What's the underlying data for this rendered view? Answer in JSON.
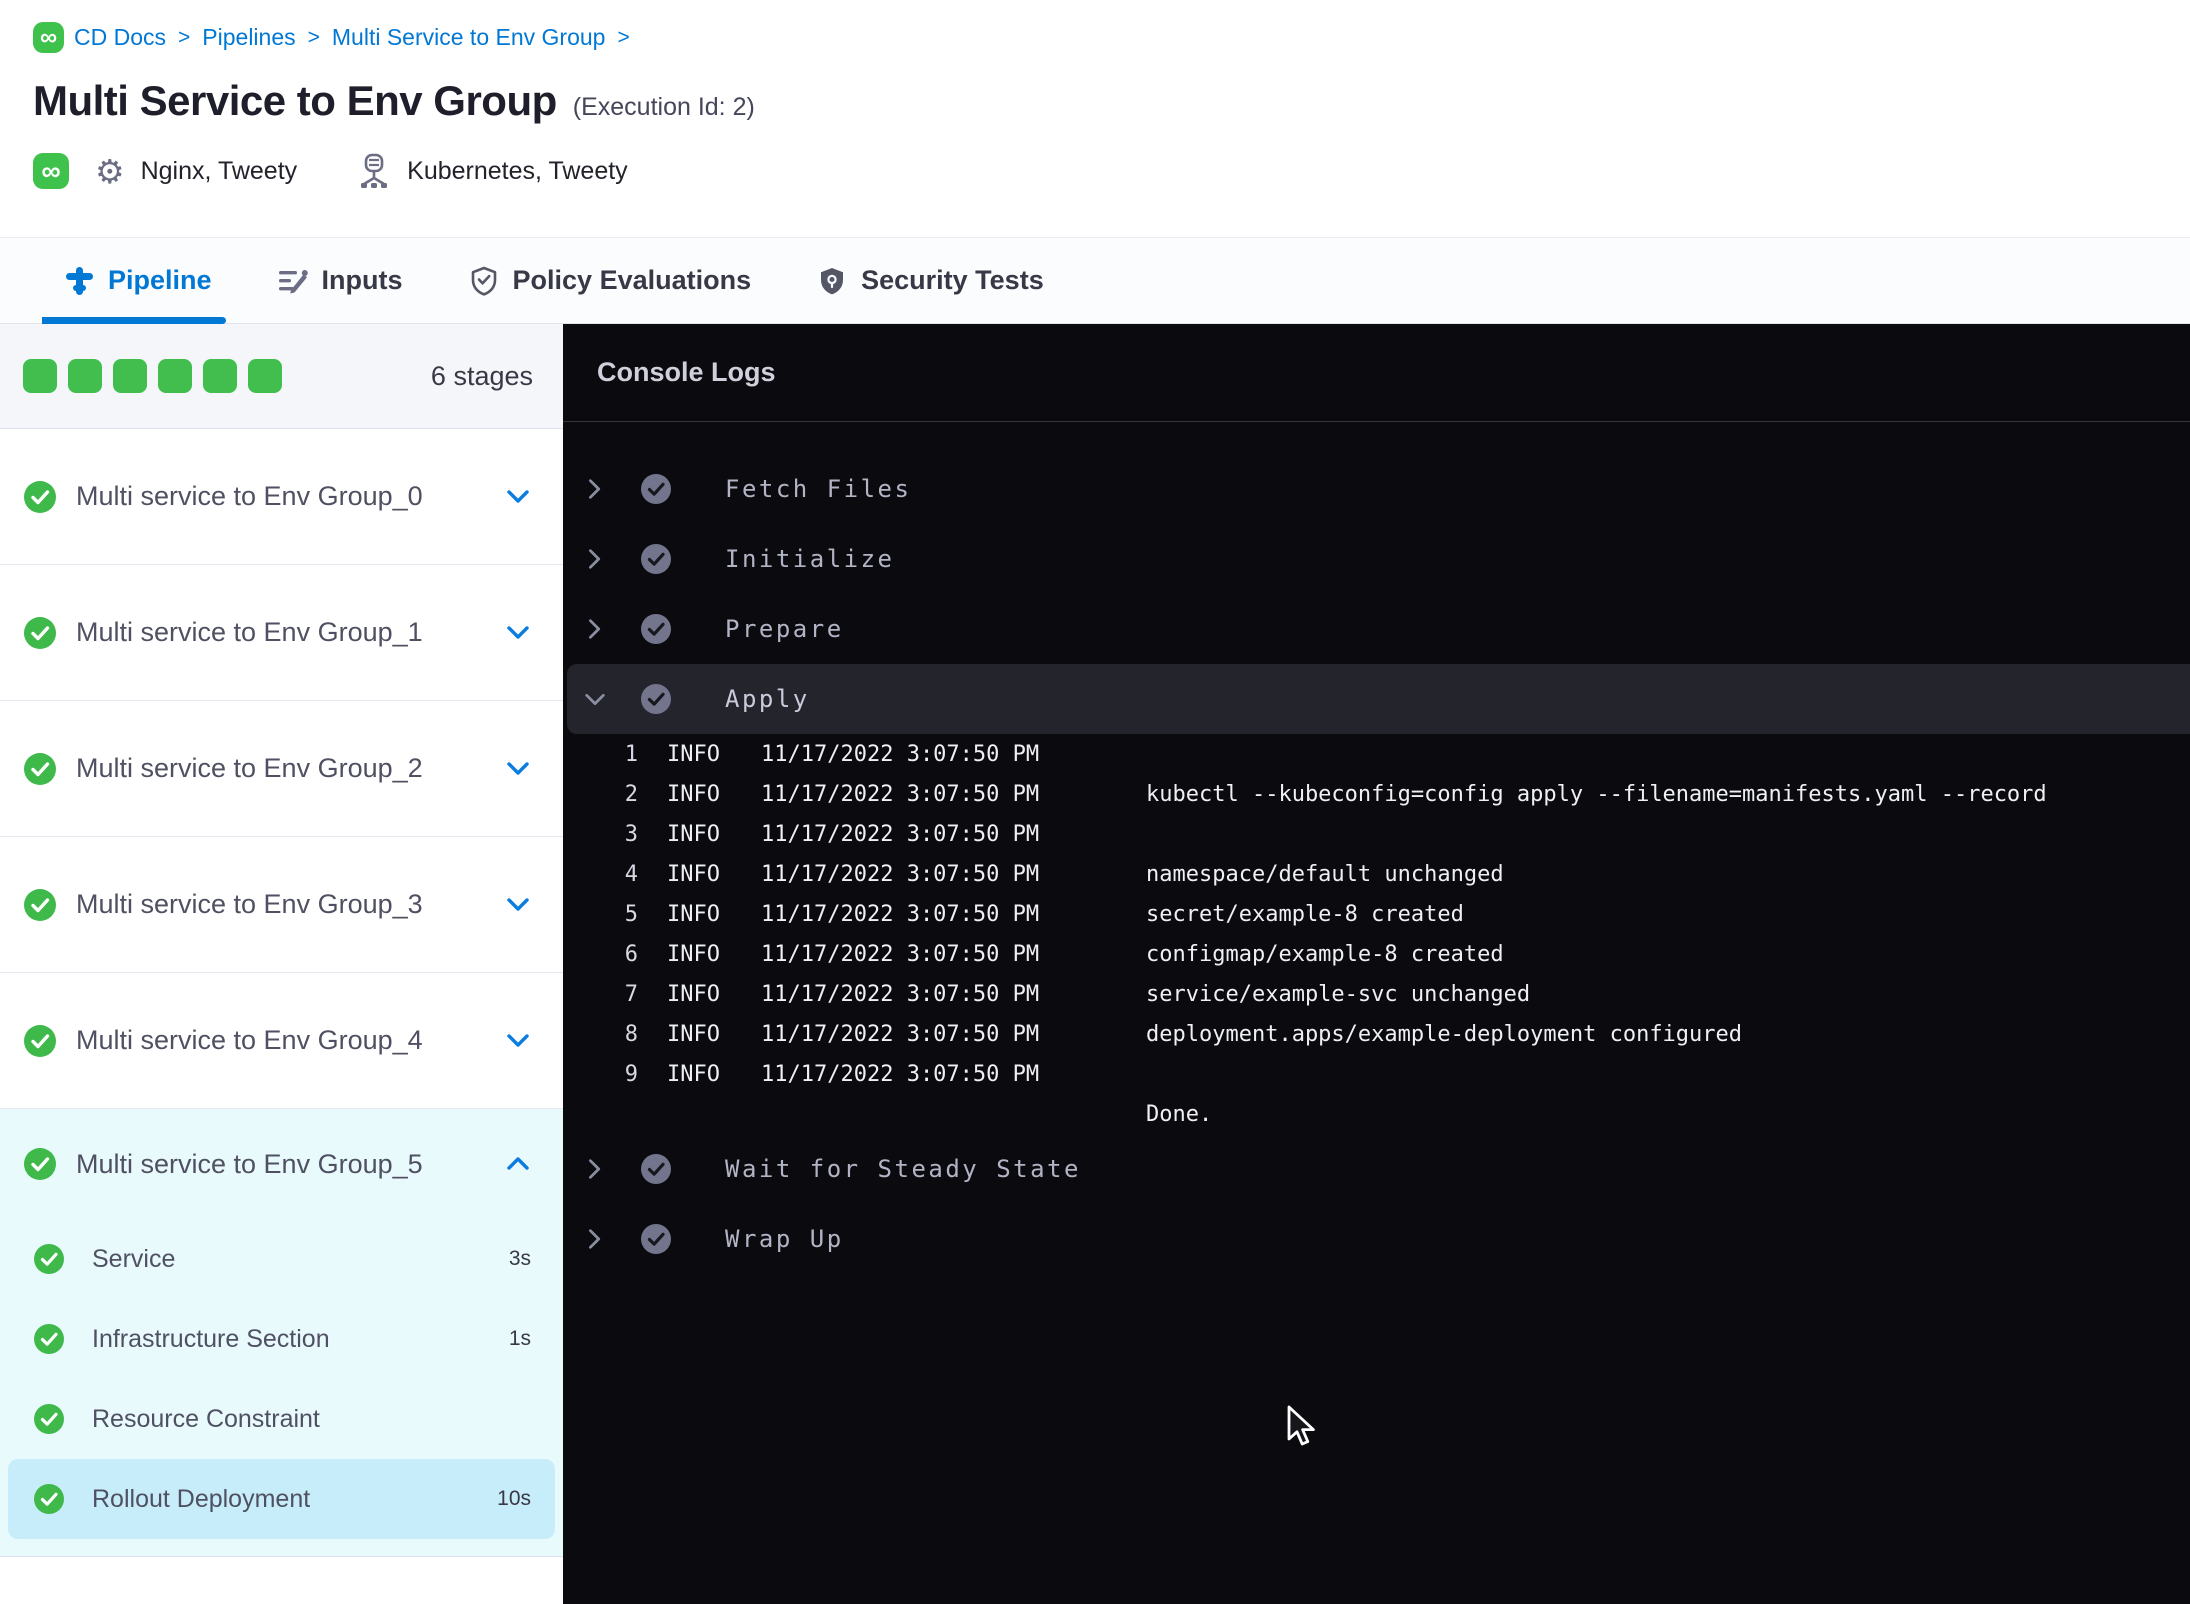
{
  "colors": {
    "accent_blue": "#0278d5",
    "success_green": "#42be4e",
    "console_bg": "#0b0b0f",
    "selected_step_bg": "#c8edfa"
  },
  "breadcrumb": {
    "separator": ">",
    "items": [
      "CD Docs",
      "Pipelines",
      "Multi Service to Env Group"
    ]
  },
  "header": {
    "title": "Multi Service to Env Group",
    "execution_id": "(Execution Id: 2)",
    "services": "Nginx, Tweety",
    "environments": "Kubernetes, Tweety"
  },
  "tabs": [
    {
      "label": "Pipeline",
      "icon": "pipeline-icon",
      "active": true
    },
    {
      "label": "Inputs",
      "icon": "inputs-icon",
      "active": false
    },
    {
      "label": "Policy Evaluations",
      "icon": "policy-shield-icon",
      "active": false
    },
    {
      "label": "Security Tests",
      "icon": "security-shield-icon",
      "active": false
    }
  ],
  "sidebar": {
    "stage_count_label": "6 stages",
    "completed_stage_squares": 6,
    "collapsed_stages": [
      "Multi service to Env Group_0",
      "Multi service to Env Group_1",
      "Multi service to Env Group_2",
      "Multi service to Env Group_3",
      "Multi service to Env Group_4"
    ],
    "expanded_stage": {
      "label": "Multi service to Env Group_5",
      "steps": [
        {
          "label": "Service",
          "duration": "3s",
          "selected": false
        },
        {
          "label": "Infrastructure Section",
          "duration": "1s",
          "selected": false
        },
        {
          "label": "Resource Constraint",
          "duration": "",
          "selected": false
        },
        {
          "label": "Rollout Deployment",
          "duration": "10s",
          "selected": true
        }
      ]
    }
  },
  "console": {
    "title": "Console Logs",
    "steps_before": [
      "Fetch Files",
      "Initialize",
      "Prepare"
    ],
    "apply": {
      "label": "Apply",
      "logs": [
        {
          "num": "1",
          "level": "INFO",
          "time": "11/17/2022 3:07:50 PM",
          "msg": ""
        },
        {
          "num": "2",
          "level": "INFO",
          "time": "11/17/2022 3:07:50 PM",
          "msg": "kubectl --kubeconfig=config apply --filename=manifests.yaml --record"
        },
        {
          "num": "3",
          "level": "INFO",
          "time": "11/17/2022 3:07:50 PM",
          "msg": ""
        },
        {
          "num": "4",
          "level": "INFO",
          "time": "11/17/2022 3:07:50 PM",
          "msg": "namespace/default unchanged"
        },
        {
          "num": "5",
          "level": "INFO",
          "time": "11/17/2022 3:07:50 PM",
          "msg": "secret/example-8 created"
        },
        {
          "num": "6",
          "level": "INFO",
          "time": "11/17/2022 3:07:50 PM",
          "msg": "configmap/example-8 created"
        },
        {
          "num": "7",
          "level": "INFO",
          "time": "11/17/2022 3:07:50 PM",
          "msg": "service/example-svc unchanged"
        },
        {
          "num": "8",
          "level": "INFO",
          "time": "11/17/2022 3:07:50 PM",
          "msg": "deployment.apps/example-deployment configured"
        },
        {
          "num": "9",
          "level": "INFO",
          "time": "11/17/2022 3:07:50 PM",
          "msg": ""
        }
      ],
      "final_line": "Done."
    },
    "steps_after": [
      "Wait for Steady State",
      "Wrap Up"
    ]
  }
}
